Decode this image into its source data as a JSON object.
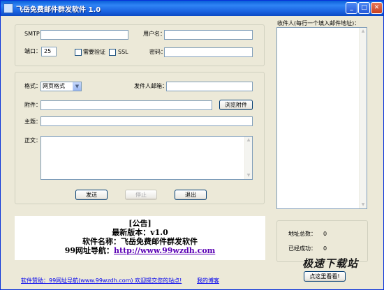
{
  "window": {
    "title": "飞岳免费邮件群发软件  1.0"
  },
  "server": {
    "smtp_label": "SMTP：",
    "smtp_value": "",
    "username_label": "用户名：",
    "username_value": "",
    "port_label": "端口：",
    "port_value": "25",
    "auth_label": "需要验证",
    "ssl_label": "SSL",
    "password_label": "密码：",
    "password_value": ""
  },
  "mail": {
    "format_label": "格式：",
    "format_selected": "网页格式",
    "sender_label": "发件人邮箱：",
    "sender_value": "",
    "attachment_label": "附件：",
    "attachment_value": "",
    "browse_button": "浏览附件",
    "subject_label": "主题：",
    "subject_value": "",
    "body_label": "正文："
  },
  "actions": {
    "send": "发送",
    "stop": "停止",
    "exit": "退出"
  },
  "recipients": {
    "label": "收件人(每行一个填入邮件地址)："
  },
  "stats": {
    "total_label": "地址总数：",
    "total_value": "0",
    "success_label": "已经成功：",
    "success_value": "0"
  },
  "announcement": {
    "line1": "[公告]",
    "line2": "最新版本：v1.0",
    "line3": "软件名称：飞岳免费邮件群发软件",
    "line4_prefix": "99网址导航：",
    "line4_link": "http://www.99wzdh.com"
  },
  "footer": {
    "sponsor": "软件赞助：99网址导航(www.99wzdh.com)  欢迎提交您的站点!",
    "blog": "我的博客",
    "look_button": "点这里看看!"
  },
  "watermark": "极速下载站"
}
